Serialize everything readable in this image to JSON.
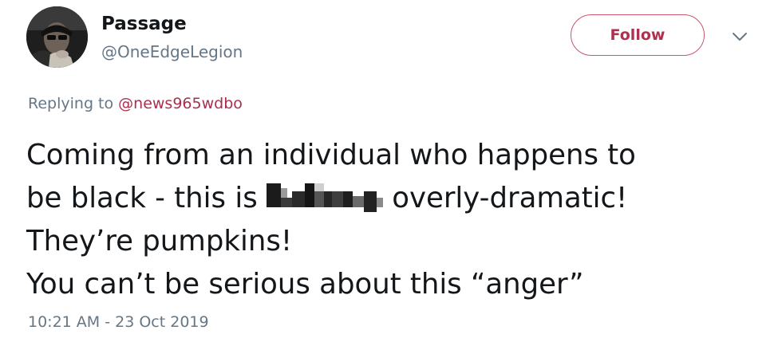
{
  "author": {
    "display_name": "Passage",
    "handle": "@OneEdgeLegion",
    "avatar_icon": "user-avatar"
  },
  "follow_button": {
    "label": "Follow",
    "accent_color": "#b0304f"
  },
  "menu": {
    "icon": "chevron-down-icon"
  },
  "reply": {
    "prefix": "Replying to ",
    "mention": "@news965wdbo"
  },
  "tweet": {
    "line1": "Coming from an individual who happens to",
    "line2_before": "be black - this is ",
    "line2_after": " overly-dramatic!",
    "line3": "They’re pumpkins!",
    "line4": "You can’t be serious about this “anger”",
    "censored_word_icon": "pixelated-censor-block"
  },
  "timestamp": "10:21 AM - 23 Oct 2019"
}
